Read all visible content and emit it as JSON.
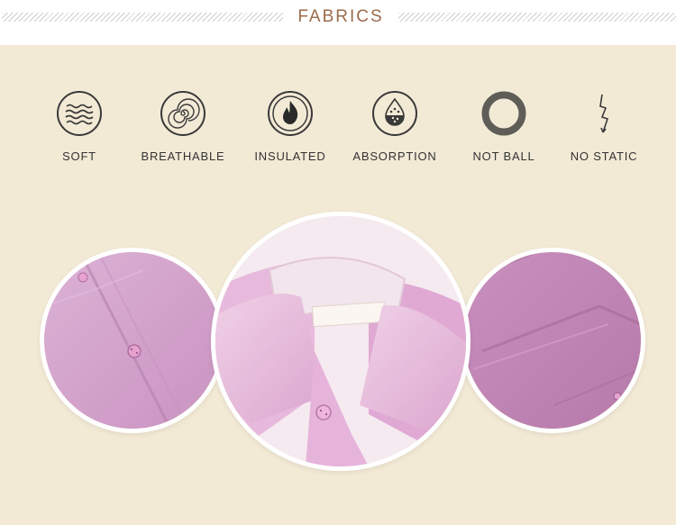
{
  "header": {
    "title": "FABRICS"
  },
  "features": [
    {
      "label": "SOFT",
      "icon": "wavy-lines-icon"
    },
    {
      "label": "BREATHABLE",
      "icon": "spiral-icon"
    },
    {
      "label": "INSULATED",
      "icon": "flame-icon"
    },
    {
      "label": "ABSORPTION",
      "icon": "water-drop-icon"
    },
    {
      "label": "NOT BALL",
      "icon": "ring-icon"
    },
    {
      "label": "NO STATIC",
      "icon": "lightning-icon"
    }
  ],
  "colors": {
    "accent": "#9b6b4a",
    "background": "#f3ead6",
    "fabric": "#d9a8cf"
  }
}
